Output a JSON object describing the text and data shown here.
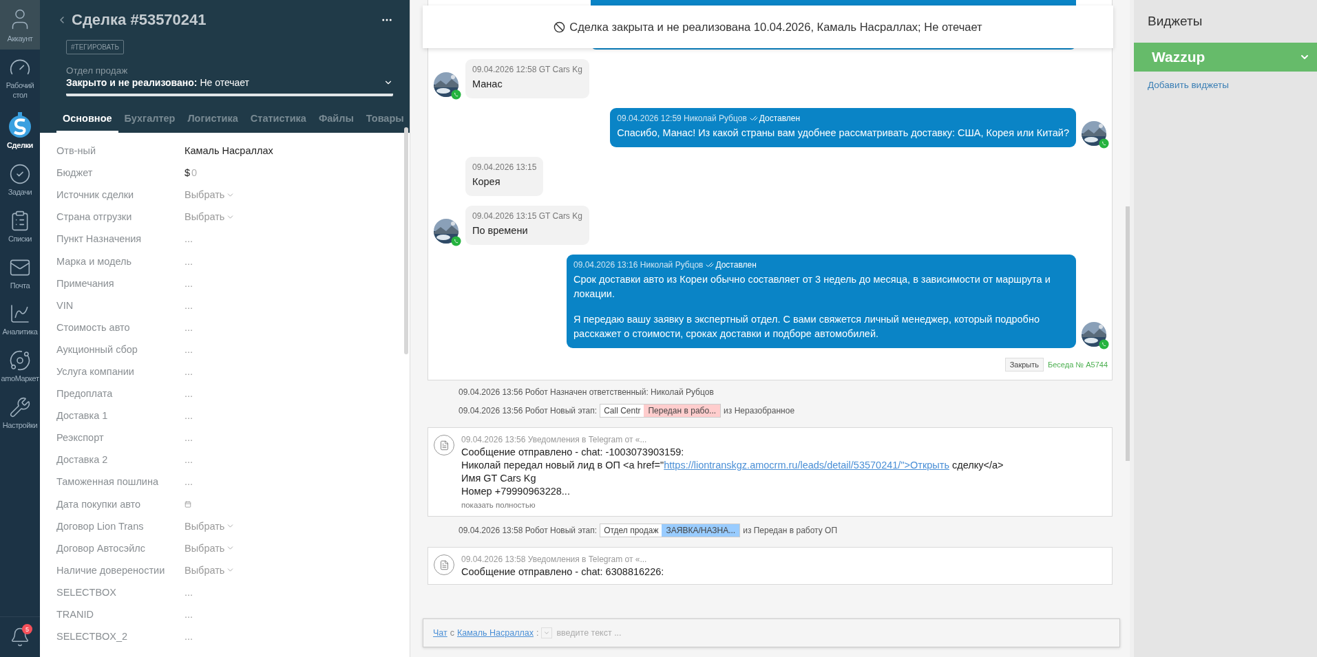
{
  "nav": {
    "items": [
      {
        "kind": "account",
        "label": "Аккаунт",
        "selected": false
      },
      {
        "kind": "dashboard",
        "label": "Рабочий стол",
        "selected": false
      },
      {
        "kind": "deals",
        "label": "Сделки",
        "selected": true
      },
      {
        "kind": "tasks",
        "label": "Задачи",
        "selected": false
      },
      {
        "kind": "lists",
        "label": "Списки",
        "selected": false
      },
      {
        "kind": "mail",
        "label": "Почта",
        "selected": false
      },
      {
        "kind": "analytics",
        "label": "Аналитика",
        "selected": false
      },
      {
        "kind": "market",
        "label": "amoМаркет",
        "selected": false
      },
      {
        "kind": "settings",
        "label": "Настройки",
        "selected": false
      }
    ],
    "notifications": {
      "badge": "5"
    }
  },
  "deal": {
    "title": "Сделка #53570241",
    "tag_button": "#ТЕГИРОВАТЬ",
    "pipeline": "Отдел продаж",
    "status_bold": "Закрыто и не реализовано:",
    "status": "Не отечает",
    "tabs": [
      {
        "label": "Основное",
        "selected": true
      },
      {
        "label": "Бухгалтер",
        "selected": false
      },
      {
        "label": "Логистика",
        "selected": false
      },
      {
        "label": "Статистика",
        "selected": false
      },
      {
        "label": "Файлы",
        "selected": false
      },
      {
        "label": "Товары",
        "selected": false
      }
    ],
    "fields": [
      {
        "label": "Отв-ный",
        "kind": "text",
        "value": "Камаль Насраллах"
      },
      {
        "label": "Бюджет",
        "kind": "money",
        "currency": "$",
        "value": "0"
      },
      {
        "label": "Источник сделки",
        "kind": "select",
        "value": "Выбрать"
      },
      {
        "label": "Страна отгрузки",
        "kind": "select",
        "value": "Выбрать"
      },
      {
        "label": "Пункт Назначения",
        "kind": "empty",
        "value": "..."
      },
      {
        "label": "Марка и модель",
        "kind": "empty",
        "value": "..."
      },
      {
        "label": "Примечания",
        "kind": "empty",
        "value": "..."
      },
      {
        "label": "VIN",
        "kind": "empty",
        "value": "..."
      },
      {
        "label": "Стоимость авто",
        "kind": "empty",
        "value": "..."
      },
      {
        "label": "Аукционный сбор",
        "kind": "empty",
        "value": "..."
      },
      {
        "label": "Услуга компании",
        "kind": "empty",
        "value": "..."
      },
      {
        "label": "Предоплата",
        "kind": "empty",
        "value": "..."
      },
      {
        "label": "Доставка 1",
        "kind": "empty",
        "value": "..."
      },
      {
        "label": "Реэкспорт",
        "kind": "empty",
        "value": "..."
      },
      {
        "label": "Доставка 2",
        "kind": "empty",
        "value": "..."
      },
      {
        "label": "Таможенная пошлина",
        "kind": "empty",
        "value": "..."
      },
      {
        "label": "Дата покупки авто",
        "kind": "date"
      },
      {
        "label": "Договор Lion Trans",
        "kind": "select",
        "value": "Выбрать"
      },
      {
        "label": "Договор Автосэйлс",
        "kind": "select",
        "value": "Выбрать"
      },
      {
        "label": "Наличие довереностии",
        "kind": "select",
        "value": "Выбрать"
      },
      {
        "label": "SELECTBOX",
        "kind": "empty",
        "value": "..."
      },
      {
        "label": "TRANID",
        "kind": "empty",
        "value": "..."
      },
      {
        "label": "SELECTBOX_2",
        "kind": "empty",
        "value": "..."
      }
    ]
  },
  "banner": {
    "text": "Сделка закрыта и не реализована 10.04.2026, Камаль Насраллах; Не отечает"
  },
  "feed": [
    {
      "kind": "chat",
      "messages": [
        {
          "kind": "in",
          "meta": "09.04.2026 12:58 GT Cars Kg",
          "text": "Манас",
          "avatar": true
        },
        {
          "kind": "out",
          "meta": "09.04.2026 12:59 Николай Рубцов",
          "status": "Доставлен",
          "paragraphs": [
            "Спасибо, Манас! Из какой страны вам удобнее рассматривать доставку: США, Корея или Китай?"
          ]
        },
        {
          "kind": "in",
          "meta": "09.04.2026 13:15",
          "text": "Корея",
          "avatar": false
        },
        {
          "kind": "in",
          "meta": "09.04.2026 13:15 GT Cars Kg",
          "text": "По времени",
          "avatar": true
        },
        {
          "kind": "out",
          "meta": "09.04.2026 13:16 Николай Рубцов",
          "status": "Доставлен",
          "paragraphs": [
            "Срок доставки авто из Кореи обычно составляет от 3 недель до месяца, в зависимости от маршрута и локации.",
            "Я передаю вашу заявку в экспертный отдел. С вами свяжется личный менеджер, который подробно расскажет о стоимости, сроках доставки и подборе автомобилей."
          ]
        }
      ],
      "close_button": "Закрыть",
      "conversation": "Беседа № A5744"
    },
    {
      "kind": "event",
      "text": "09.04.2026 13:56 Робот Назначен ответственный: Николай Рубцов"
    },
    {
      "kind": "stage",
      "text": "09.04.2026 13:56 Робот Новый этап:",
      "pipeline": "Call Centr",
      "stage": "Передан в рабо...",
      "color": "#ffcdcd",
      "suffix": "из Неразобранное"
    },
    {
      "kind": "note",
      "header": "09.04.2026 13:56 Уведомления в Telegram от «...",
      "lines": [
        {
          "text": "Сообщение отправлено - chat: -1003073903159:"
        },
        {
          "text": "Николай передал новый лид в ОП <a href=\"",
          "link": "https://liontranskgz.amocrm.ru/leads/detail/53570241/\">Открыть",
          "after": " сделку</a>"
        },
        {
          "text": "Имя GT Cars Kg"
        },
        {
          "text": "Номер +79990963228..."
        }
      ],
      "more": "показать полностью"
    },
    {
      "kind": "stage",
      "text": "09.04.2026 13:58 Робот Новый этап:",
      "pipeline": "Отдел продаж",
      "stage": "ЗАЯВКА/НАЗНА...",
      "color": "#99ccff",
      "suffix": "из Передан в работу ОП"
    },
    {
      "kind": "note",
      "header": "09.04.2026 13:58 Уведомления в Telegram от «...",
      "lines": [
        {
          "text": "Сообщение отправлено - chat: 6308816226:"
        }
      ]
    }
  ],
  "composer": {
    "chat_link": "Чат",
    "with": "с",
    "contact": "Камаль Насраллах",
    "separator": ":",
    "placeholder": "введите текст ..."
  },
  "widgets": {
    "title": "Виджеты",
    "items": [
      {
        "name": "Wazzup",
        "color": "#66bb6a"
      }
    ],
    "add_link": "Добавить виджеты"
  }
}
